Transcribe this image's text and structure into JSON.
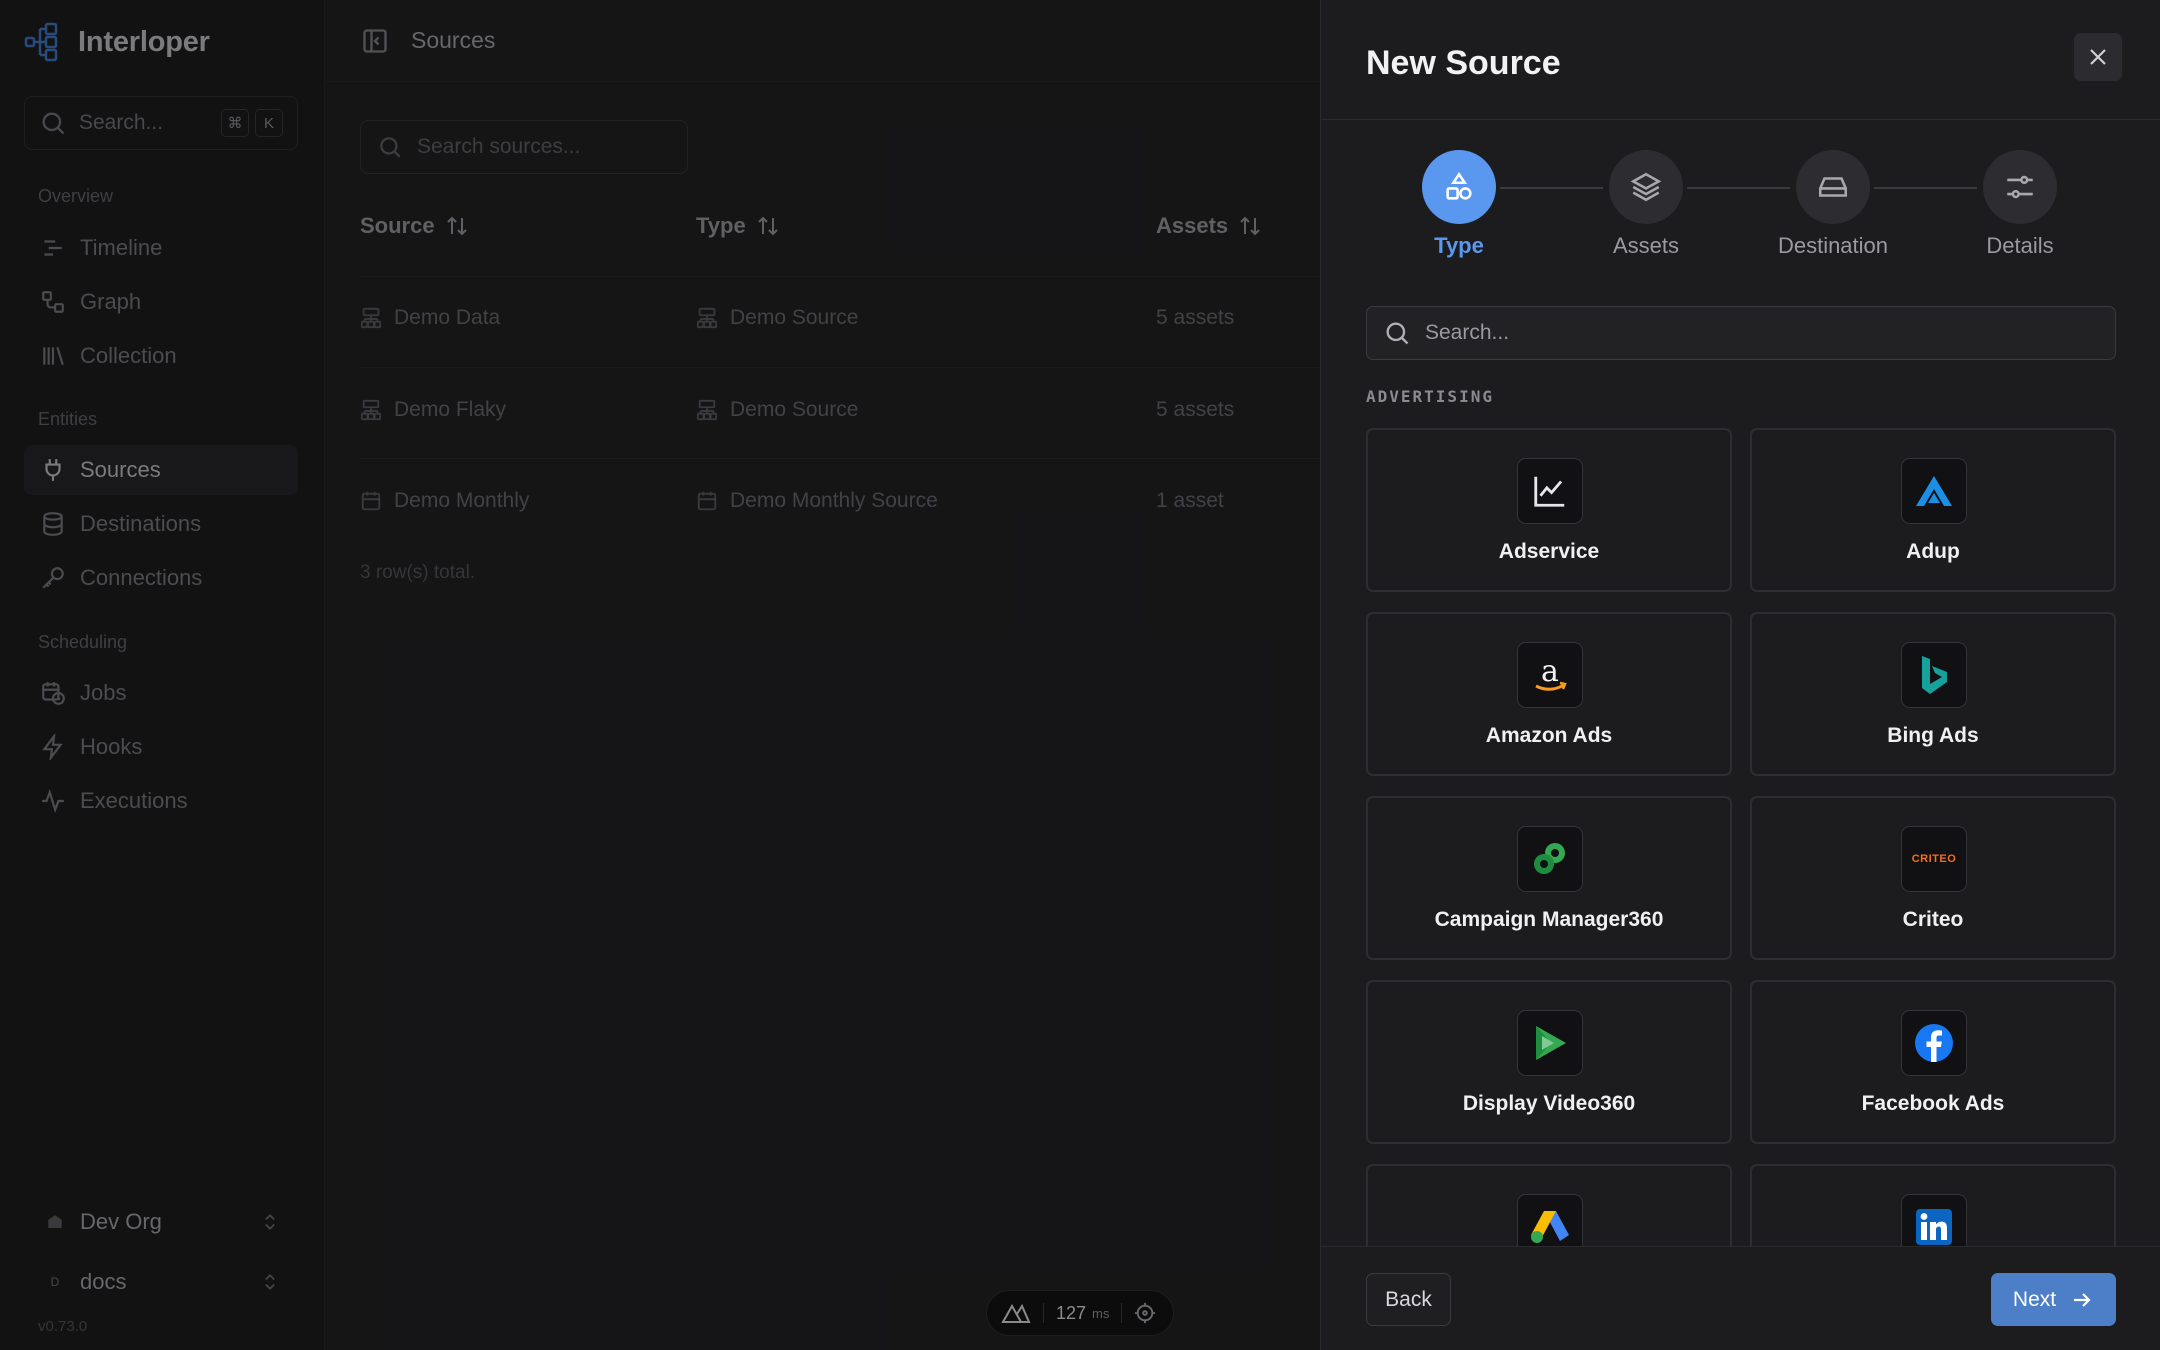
{
  "sidebar": {
    "brand": "Interloper",
    "search_placeholder": "Search...",
    "shortcut_keys": [
      "⌘",
      "K"
    ],
    "sections": {
      "overview": "Overview",
      "entities": "Entities",
      "scheduling": "Scheduling"
    },
    "items": {
      "timeline": "Timeline",
      "graph": "Graph",
      "collection": "Collection",
      "sources": "Sources",
      "destinations": "Destinations",
      "connections": "Connections",
      "jobs": "Jobs",
      "hooks": "Hooks",
      "executions": "Executions"
    },
    "active_item": "sources",
    "org": "Dev Org",
    "workspace": "docs",
    "workspace_initial": "D",
    "version": "v0.73.0"
  },
  "main": {
    "title": "Sources",
    "search_placeholder": "Search sources...",
    "columns": [
      "Source",
      "Type",
      "Assets"
    ],
    "rows": [
      {
        "source": "Demo Data",
        "type": "Demo Source",
        "assets": "5 assets",
        "icon": "hierarchy-icon"
      },
      {
        "source": "Demo Flaky",
        "type": "Demo Source",
        "assets": "5 assets",
        "icon": "hierarchy-icon"
      },
      {
        "source": "Demo Monthly",
        "type": "Demo Monthly Source",
        "assets": "1 asset",
        "icon": "calendar-icon"
      }
    ],
    "total": "3 row(s) total.",
    "devbar": {
      "value": "127",
      "unit": "ms"
    }
  },
  "panel": {
    "title": "New Source",
    "steps": [
      {
        "label": "Type",
        "icon": "shapes-icon",
        "active": true
      },
      {
        "label": "Assets",
        "icon": "layers-icon",
        "active": false
      },
      {
        "label": "Destination",
        "icon": "hard-drive-icon",
        "active": false
      },
      {
        "label": "Details",
        "icon": "sliders-icon",
        "active": false
      }
    ],
    "search_placeholder": "Search...",
    "category": "ADVERTISING",
    "cards": [
      {
        "name": "Adservice",
        "icon": "line-chart-icon"
      },
      {
        "name": "Adup",
        "icon": "adup-logo-icon"
      },
      {
        "name": "Amazon Ads",
        "icon": "amazon-logo-icon"
      },
      {
        "name": "Bing Ads",
        "icon": "bing-logo-icon"
      },
      {
        "name": "Campaign Manager360",
        "icon": "campaign-manager-logo-icon"
      },
      {
        "name": "Criteo",
        "icon": "criteo-logo-icon",
        "logo_text": "CRITEO"
      },
      {
        "name": "Display Video360",
        "icon": "display-video-logo-icon"
      },
      {
        "name": "Facebook Ads",
        "icon": "facebook-logo-icon"
      },
      {
        "name": "",
        "icon": "google-ads-logo-icon"
      },
      {
        "name": "",
        "icon": "linkedin-logo-icon"
      }
    ],
    "back_label": "Back",
    "next_label": "Next"
  },
  "colors": {
    "accent": "#5a98f0",
    "next_button": "#4d7fc9",
    "panel_bg": "#1c1c1e"
  }
}
